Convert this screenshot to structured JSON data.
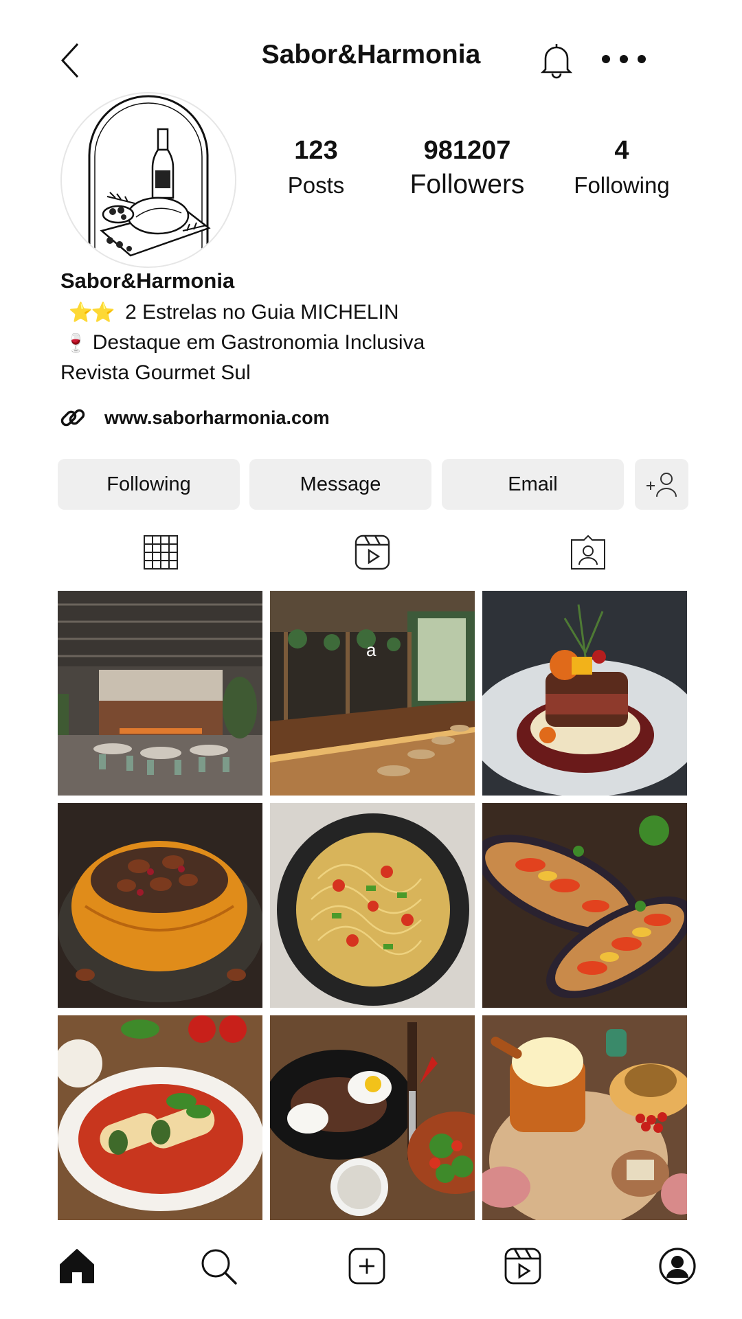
{
  "header": {
    "title": "Sabor&Harmonia",
    "back_icon": "chevron-left-icon",
    "bell_icon": "bell-icon",
    "more_icon": "more-horizontal-icon"
  },
  "profile": {
    "avatar_icon": "restaurant-logo",
    "stats": {
      "posts_count": "123",
      "posts_label": "Posts",
      "followers_count": "981207",
      "followers_label": "Followers",
      "following_count": "4",
      "following_label": "Following"
    },
    "bio": {
      "name": "Sabor&Harmonia",
      "line1_emoji": "⭐⭐",
      "line1_text": "2 Estrelas no Guia MICHELIN",
      "line2_emoji": "🍷",
      "line2_text": "Destaque em Gastronomia Inclusiva",
      "line3_text": "Revista Gourmet Sul",
      "link": "www.saborharmonia.com"
    }
  },
  "actions": {
    "following_label": "Following",
    "message_label": "Message",
    "email_label": "Email",
    "add_person_icon": "add-person-icon"
  },
  "tabs": [
    "grid-icon",
    "reels-icon",
    "tagged-icon"
  ],
  "posts": [
    {
      "subject": "restaurant dining room"
    },
    {
      "subject": "bar counter",
      "overlay_text": "a"
    },
    {
      "subject": "steak on puree"
    },
    {
      "subject": "stuffed pumpkin"
    },
    {
      "subject": "spaghetti in pan"
    },
    {
      "subject": "stuffed eggplants"
    },
    {
      "subject": "cannelloni"
    },
    {
      "subject": "steak with eggs"
    },
    {
      "subject": "fondue table"
    }
  ],
  "bottom_nav": [
    "home-icon",
    "search-icon",
    "create-icon",
    "reels-icon",
    "profile-icon"
  ],
  "colors": {
    "button_bg": "#efefef",
    "text": "#111111",
    "star": "#f5a623"
  }
}
